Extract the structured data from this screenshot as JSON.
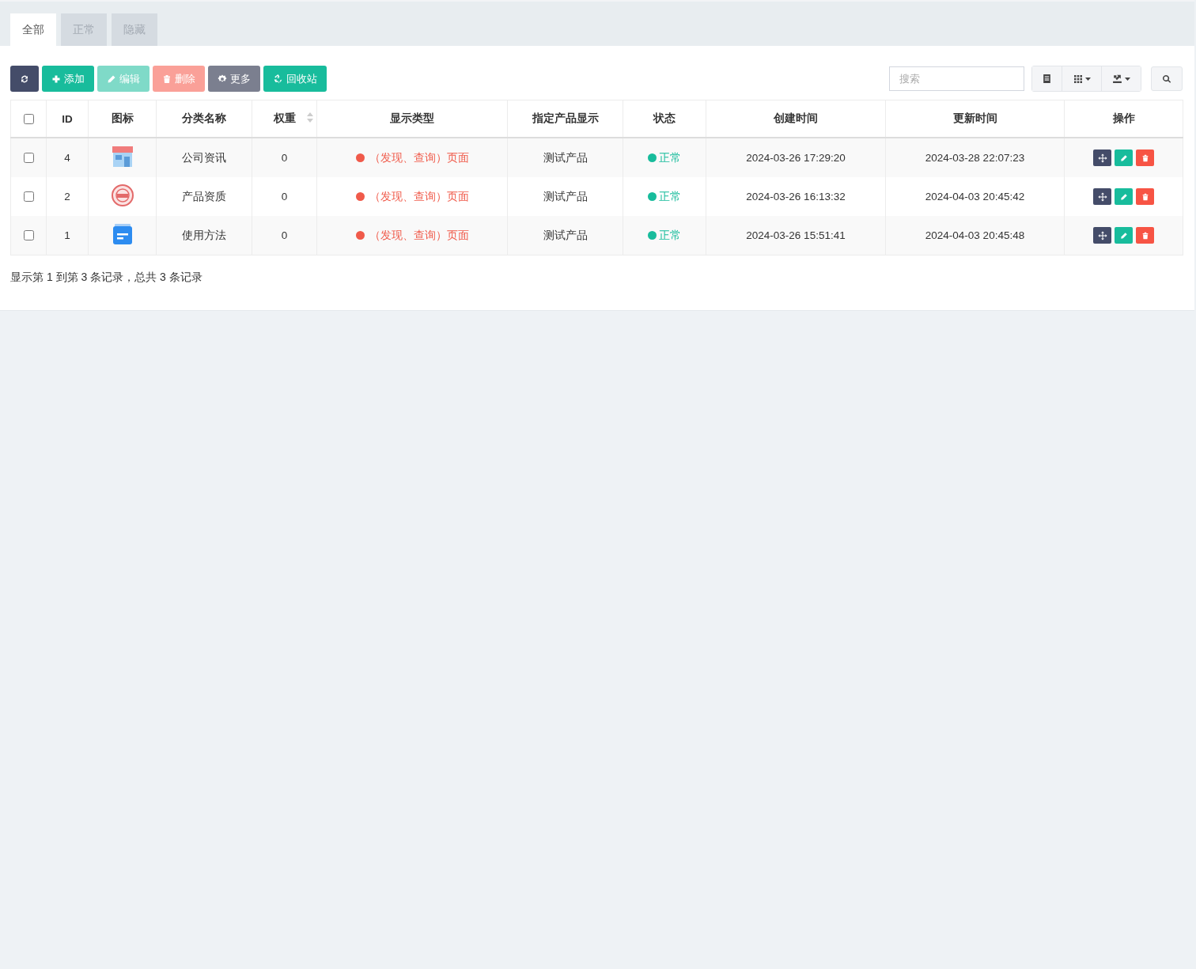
{
  "tabs": [
    {
      "label": "全部",
      "selected": true
    },
    {
      "label": "正常",
      "selected": false
    },
    {
      "label": "隐藏",
      "selected": false
    }
  ],
  "toolbar": [
    {
      "kind": "refresh",
      "disabled": false
    },
    {
      "kind": "add",
      "label": "添加",
      "disabled": false
    },
    {
      "kind": "edit",
      "label": "编辑",
      "disabled": true
    },
    {
      "kind": "delete",
      "label": "删除",
      "disabled": true
    },
    {
      "kind": "more",
      "label": "更多",
      "disabled": false
    },
    {
      "kind": "recycle",
      "label": "回收站",
      "disabled": false
    }
  ],
  "search": {
    "placeholder": "搜索"
  },
  "table": {
    "columns": [
      {
        "label": "ID",
        "sortable": false
      },
      {
        "label": "图标",
        "sortable": false
      },
      {
        "label": "分类名称",
        "sortable": false
      },
      {
        "label": "权重",
        "sortable": true
      },
      {
        "label": "显示类型",
        "sortable": false
      },
      {
        "label": "指定产品显示",
        "sortable": false
      },
      {
        "label": "状态",
        "sortable": false
      },
      {
        "label": "创建时间",
        "sortable": false
      },
      {
        "label": "更新时间",
        "sortable": false
      },
      {
        "label": "操作",
        "sortable": false
      }
    ],
    "all_checked": false,
    "rows": [
      {
        "checked": false,
        "id": "4",
        "kind": "shop",
        "name": "公司资讯",
        "weight": "0",
        "display_type": "（发现、查询）页面",
        "product": "测试产品",
        "status": "正常",
        "created": "2024-03-26 17:29:20",
        "updated": "2024-03-28 22:07:23"
      },
      {
        "checked": false,
        "id": "2",
        "kind": "stamp",
        "name": "产品资质",
        "weight": "0",
        "display_type": "（发现、查询）页面",
        "product": "测试产品",
        "status": "正常",
        "created": "2024-03-26 16:13:32",
        "updated": "2024-04-03 20:45:42"
      },
      {
        "checked": false,
        "id": "1",
        "kind": "card",
        "name": "使用方法",
        "weight": "0",
        "display_type": "（发现、查询）页面",
        "product": "测试产品",
        "status": "正常",
        "created": "2024-03-26 15:51:41",
        "updated": "2024-04-03 20:45:48"
      }
    ]
  },
  "pagination": {
    "summary": "显示第 1 到第 3 条记录，总共 3 条记录"
  }
}
